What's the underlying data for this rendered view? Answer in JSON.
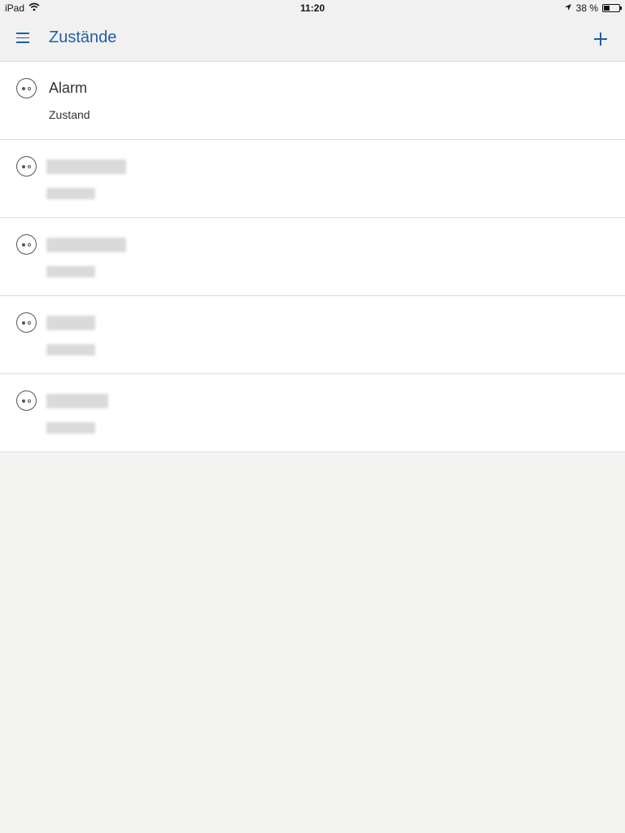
{
  "status_bar": {
    "device": "iPad",
    "time": "11:20",
    "battery": "38 %"
  },
  "nav": {
    "title": "Zustände"
  },
  "rows": [
    {
      "title": "Alarm",
      "subtitle": "Zustand",
      "redacted": false
    },
    {
      "title": "",
      "subtitle": "",
      "redacted": true
    },
    {
      "title": "",
      "subtitle": "",
      "redacted": true
    },
    {
      "title": "",
      "subtitle": "",
      "redacted": true
    },
    {
      "title": "",
      "subtitle": "",
      "redacted": true
    }
  ],
  "colors": {
    "accent": "#1f5fa8",
    "background": "#f4f4f2",
    "row_background": "#ffffff"
  },
  "icons": [
    "wifi-icon",
    "location-arrow-icon",
    "battery-icon",
    "hamburger-menu-icon",
    "plus-icon",
    "state-toggle-icon"
  ]
}
